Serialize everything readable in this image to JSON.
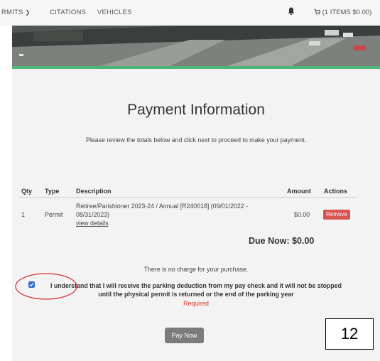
{
  "nav": {
    "items": [
      {
        "label": "RMITS",
        "has_chevron": true
      },
      {
        "label": "CITATIONS",
        "has_chevron": false
      },
      {
        "label": "VEHICLES",
        "has_chevron": false
      }
    ],
    "bell_icon": "bell-icon",
    "cart_icon": "cart-icon",
    "cart_label": "(1 ITEMS $0.00)"
  },
  "page": {
    "title": "Payment Information",
    "subtitle": "Please review the totals below and click next to proceed to make your payment."
  },
  "table": {
    "headers": [
      "Qty",
      "Type",
      "Description",
      "Amount",
      "Actions"
    ],
    "rows": [
      {
        "qty": "1",
        "type": "Permit",
        "description_line1": "Retiree/Parishioner 2023-24 / Annual [R240018] (09/01/2022 -",
        "description_line2": "08/31/2023)",
        "details_link": "view details",
        "amount": "$0.00",
        "action": "Remove"
      }
    ]
  },
  "due_now": "Due Now: $0.00",
  "no_charge_text": "There is no charge for your purchase.",
  "agreement": {
    "checked": true,
    "line1": "I understand that I will receive the parking deduction from my pay check and it will not be stopped",
    "line2": "until the physical permit is returned or the end of the parking year",
    "required": "Required"
  },
  "pay_button": "Pay Now",
  "annotation": {
    "number": "12"
  },
  "colors": {
    "accent_green": "#4fb577",
    "remove_red": "#d9534f",
    "required_red": "#d9342b",
    "checkbox_blue": "#2f6fd1",
    "pay_gray": "#7b7b7b",
    "annotation_ellipse": "#d32f2f"
  }
}
